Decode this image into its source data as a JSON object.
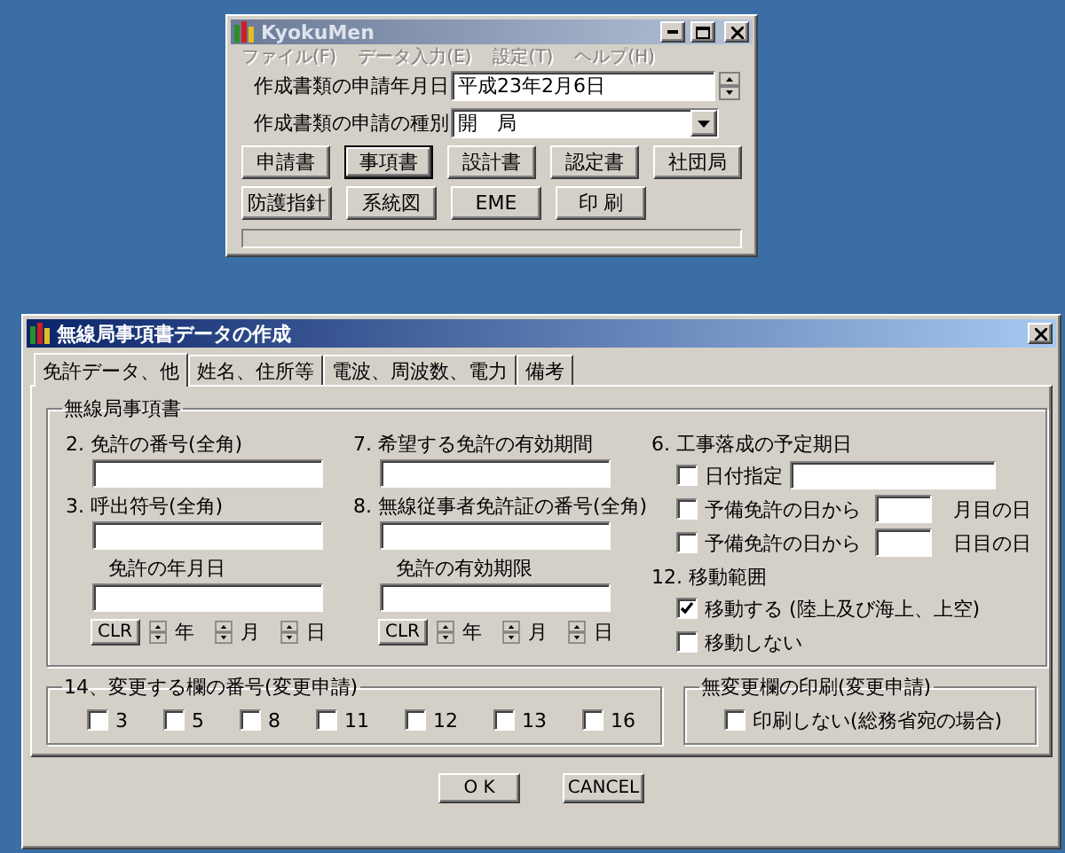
{
  "main_window": {
    "title": "KyokuMen",
    "menu": [
      {
        "label": "ファイル(F)",
        "disabled": true
      },
      {
        "label": "データ入力(E)",
        "disabled": true
      },
      {
        "label": "設定(T)",
        "disabled": true
      },
      {
        "label": "ヘルプ(H)",
        "disabled": true
      }
    ],
    "fields": [
      {
        "kind": "spin",
        "label": "作成書類の申請年月日",
        "value": "平成23年2月6日"
      },
      {
        "kind": "dropdown",
        "label": "作成書類の申請の種別",
        "value": "開　局"
      }
    ],
    "button_rows": [
      [
        {
          "label": "申請書",
          "selected": false
        },
        {
          "label": "事項書",
          "selected": true
        },
        {
          "label": "設計書",
          "selected": false
        },
        {
          "label": "認定書",
          "selected": false
        },
        {
          "label": "社団局",
          "selected": false
        }
      ],
      [
        {
          "label": "防護指針",
          "selected": false
        },
        {
          "label": "系統図",
          "selected": false
        },
        {
          "label": "EME",
          "selected": false
        },
        {
          "label": "印 刷",
          "selected": false
        }
      ]
    ]
  },
  "dialog": {
    "title": "無線局事項書データの作成",
    "tabs": [
      {
        "label": "免許データ、他",
        "selected": true
      },
      {
        "label": "姓名、住所等",
        "selected": false
      },
      {
        "label": "電波、周波数、電力",
        "selected": false
      },
      {
        "label": "備考",
        "selected": false
      }
    ],
    "group": {
      "title": "無線局事項書",
      "columns": [
        [
          {
            "kind": "field",
            "label": "2. 免許の番号(全角)"
          },
          {
            "kind": "field",
            "label": "3. 呼出符号(全角)"
          },
          {
            "kind": "date",
            "label": "免許の年月日",
            "clear": "CLR",
            "parts": [
              "年",
              "月",
              "日"
            ]
          }
        ],
        [
          {
            "kind": "field",
            "label": "7. 希望する免許の有効期間"
          },
          {
            "kind": "field",
            "label": "8. 無線従事者免許証の番号(全角)"
          },
          {
            "kind": "date",
            "label": "免許の有効期限",
            "clear": "CLR",
            "parts": [
              "年",
              "月",
              "日"
            ]
          }
        ]
      ],
      "sections": [
        {
          "heading": "6. 工事落成の予定期日",
          "options": [
            {
              "kind": "wide",
              "label": "日付指定",
              "checked": false
            },
            {
              "kind": "short",
              "label": "予備免許の日から",
              "checked": false,
              "suffix": "月目の日"
            },
            {
              "kind": "short",
              "label": "予備免許の日から",
              "checked": false,
              "suffix": "日目の日"
            }
          ]
        },
        {
          "heading": "12. 移動範囲",
          "options": [
            {
              "kind": "plain",
              "label": "移動する (陸上及び海上、上空)",
              "checked": true
            },
            {
              "kind": "plain",
              "label": "移動しない",
              "checked": false
            }
          ]
        }
      ]
    },
    "change_group": {
      "title": "14、変更する欄の番号(変更申請)",
      "options": [
        {
          "label": "3",
          "checked": false
        },
        {
          "label": "5",
          "checked": false
        },
        {
          "label": "8",
          "checked": false
        },
        {
          "label": "11",
          "checked": false
        },
        {
          "label": "12",
          "checked": false
        },
        {
          "label": "13",
          "checked": false
        },
        {
          "label": "16",
          "checked": false
        }
      ]
    },
    "print_group": {
      "title": "無変更欄の印刷(変更申請)",
      "options": [
        {
          "label": "印刷しない(総務省宛の場合)",
          "checked": false
        }
      ]
    },
    "buttons": [
      "O K",
      "CANCEL"
    ]
  }
}
